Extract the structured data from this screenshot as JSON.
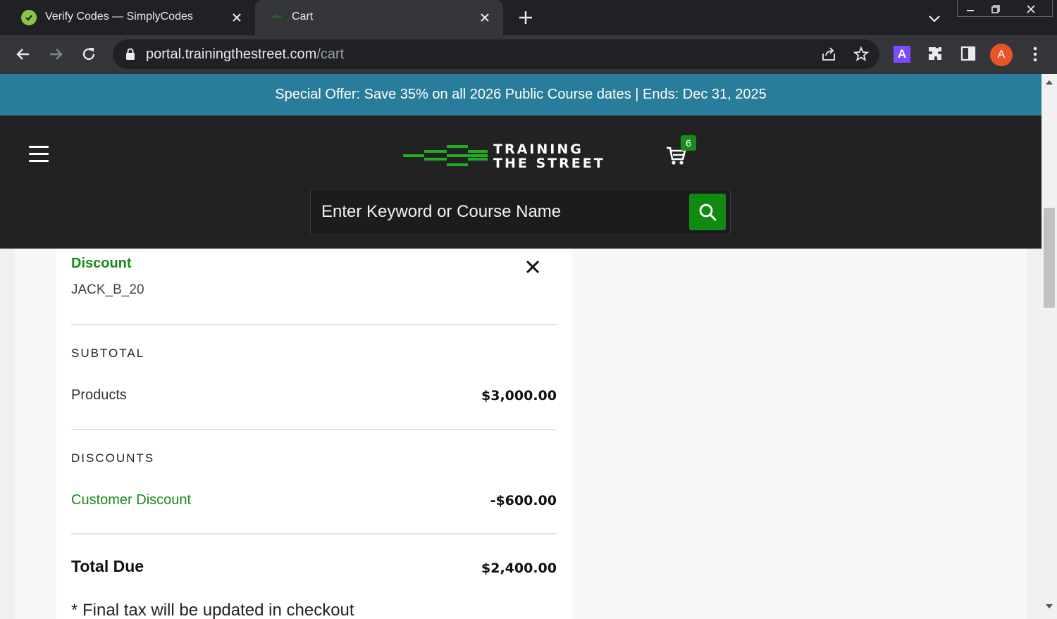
{
  "browser": {
    "tabs": [
      {
        "title": "Verify Codes — SimplyCodes",
        "favicon": "simplycodes-check-icon",
        "active": false
      },
      {
        "title": "Cart",
        "favicon": "trainingthestreet-favicon",
        "active": true
      }
    ],
    "url_host": "portal.trainingthestreet.com",
    "url_path": "/cart",
    "extension_label": "A",
    "profile_initial": "A"
  },
  "promo": {
    "text": "Special Offer: Save 35% on all 2026 Public Course dates | Ends: Dec 31, 2025"
  },
  "header": {
    "logo_line1": "TRAINING",
    "logo_line2": "THE STREET",
    "cart_count": "6",
    "search_placeholder": "Enter Keyword or Course Name"
  },
  "order_summary": {
    "discount_title": "Discount",
    "discount_code": "JACK_B_20",
    "subtotal_label": "SUBTOTAL",
    "products_label": "Products",
    "products_value": "$3,000.00",
    "discounts_label": "DISCOUNTS",
    "customer_discount_label": "Customer Discount",
    "customer_discount_value": "-$600.00",
    "total_label": "Total Due",
    "total_value": "$2,400.00",
    "tax_note": "* Final tax will be updated in checkout"
  },
  "colors": {
    "brand_green": "#1a8a1a",
    "promo_bar": "#2a7d9a",
    "header_bg": "#222222"
  }
}
